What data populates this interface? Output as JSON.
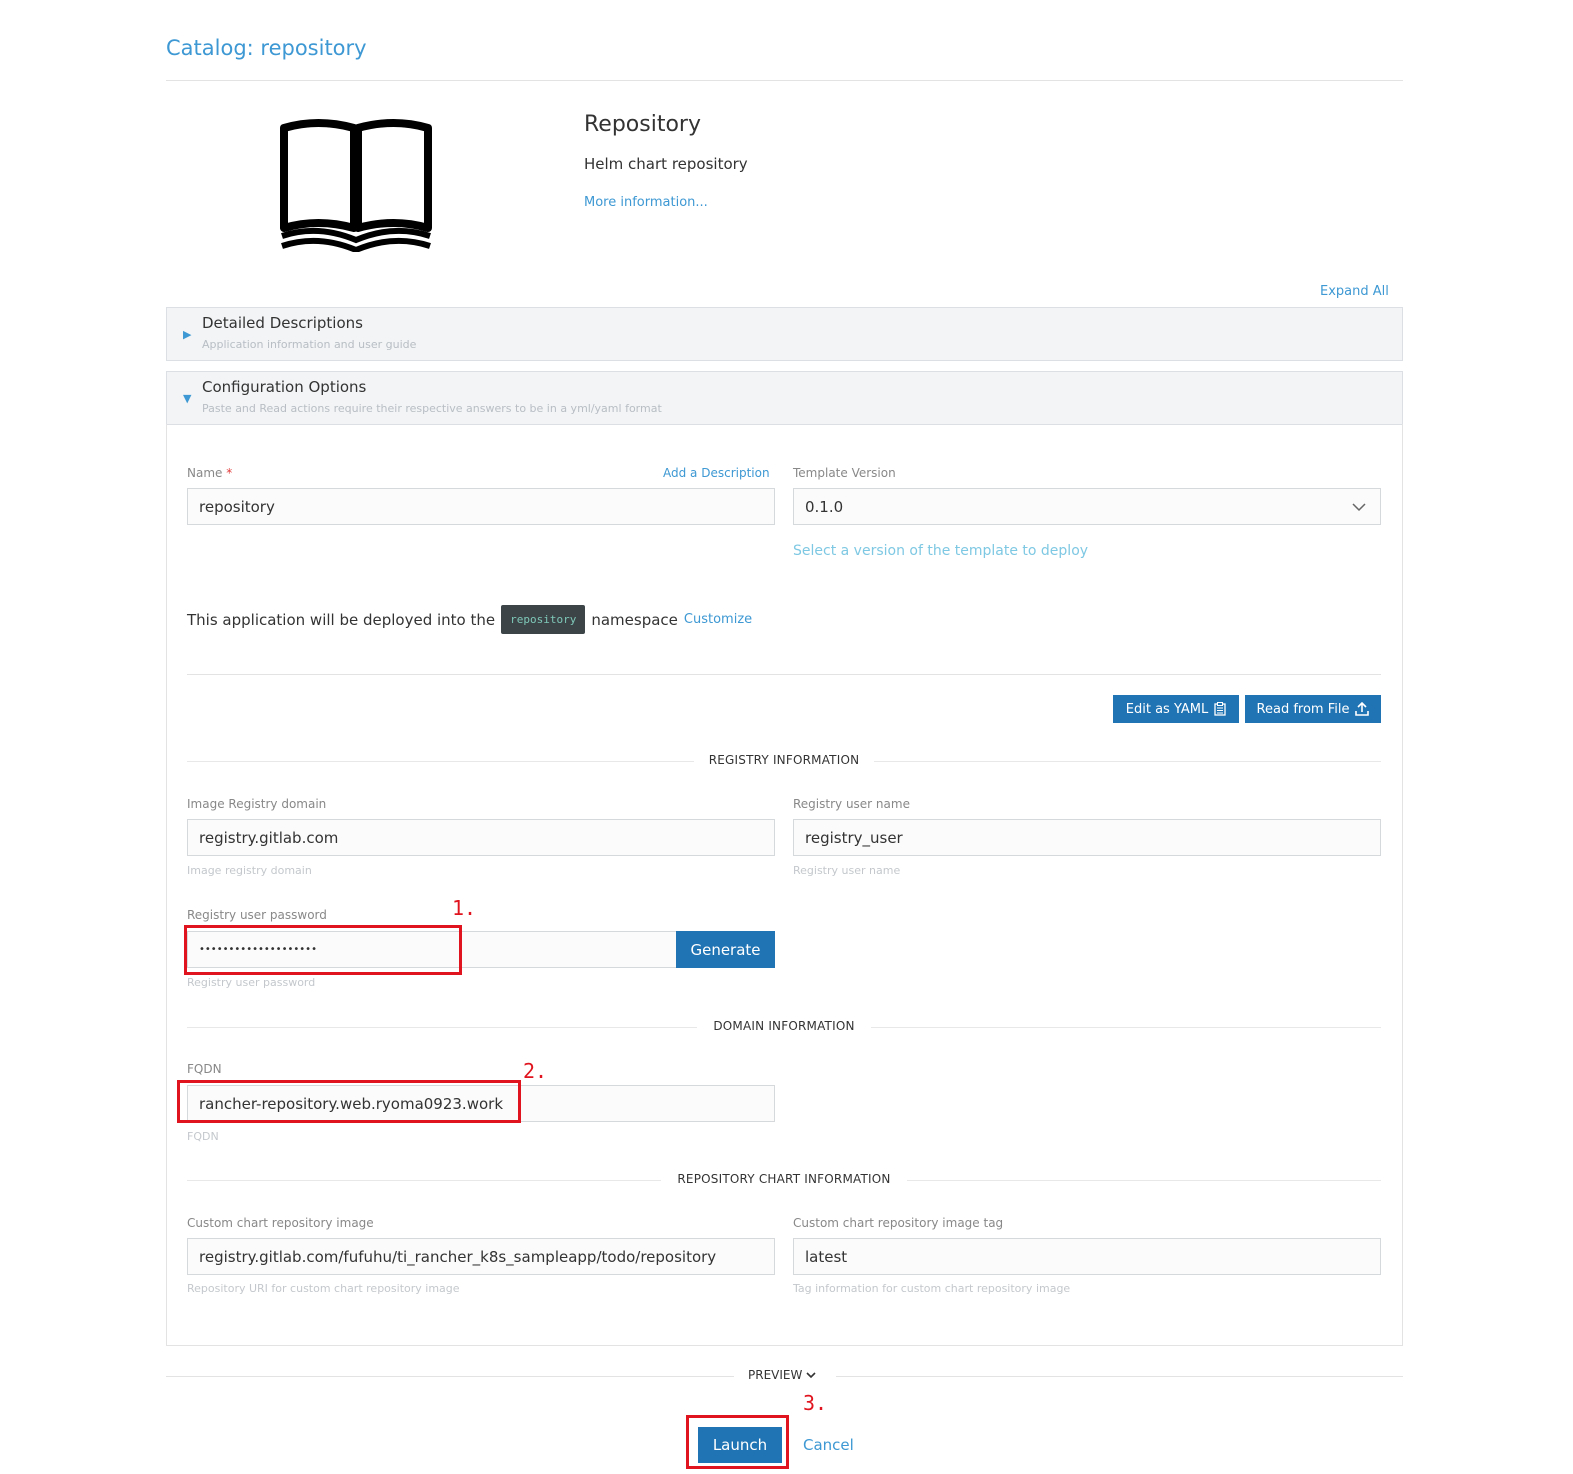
{
  "header": {
    "title": "Catalog: repository"
  },
  "app": {
    "name": "Repository",
    "description": "Helm chart repository",
    "more_info": "More information..."
  },
  "expand_all": "Expand All",
  "accordions": [
    {
      "title": "Detailed Descriptions",
      "subtitle": "Application information and user guide",
      "expanded": false
    },
    {
      "title": "Configuration Options",
      "subtitle": "Paste and Read actions require their respective answers to be in a yml/yaml format",
      "expanded": true
    }
  ],
  "form": {
    "name_label": "Name",
    "required_mark": "*",
    "add_description": "Add a Description",
    "name_value": "repository",
    "template_version_label": "Template Version",
    "template_version_value": "0.1.0",
    "template_version_help": "Select a version of the template to deploy",
    "namespace_prefix": "This application will be deployed into the",
    "namespace_badge": "repository",
    "namespace_suffix": "namespace",
    "customize": "Customize",
    "edit_yaml": "Edit as YAML",
    "read_file": "Read from File",
    "sections": {
      "registry": "REGISTRY INFORMATION",
      "domain": "DOMAIN INFORMATION",
      "chart": "REPOSITORY CHART INFORMATION"
    },
    "registry_domain_label": "Image Registry domain",
    "registry_domain_value": "registry.gitlab.com",
    "registry_domain_help": "Image registry domain",
    "registry_user_label": "Registry user name",
    "registry_user_value": "registry_user",
    "registry_user_help": "Registry user name",
    "registry_password_label": "Registry user password",
    "registry_password_value": "••••••••••••••••••••",
    "registry_password_help": "Registry user password",
    "generate": "Generate",
    "fqdn_label": "FQDN",
    "fqdn_value": "rancher-repository.web.ryoma0923.work",
    "fqdn_help": "FQDN",
    "chart_image_label": "Custom chart repository image",
    "chart_image_value": "registry.gitlab.com/fufuhu/ti_rancher_k8s_sampleapp/todo/repository",
    "chart_image_help": "Repository URI for custom chart repository image",
    "chart_tag_label": "Custom chart repository image tag",
    "chart_tag_value": "latest",
    "chart_tag_help": "Tag information for custom chart repository image"
  },
  "footer": {
    "preview": "PREVIEW",
    "launch": "Launch",
    "cancel": "Cancel"
  },
  "annotations": [
    "1.",
    "2.",
    "3."
  ],
  "colors": {
    "accent": "#3d98d3",
    "button": "#2174b4",
    "annotation": "#e0141e"
  }
}
